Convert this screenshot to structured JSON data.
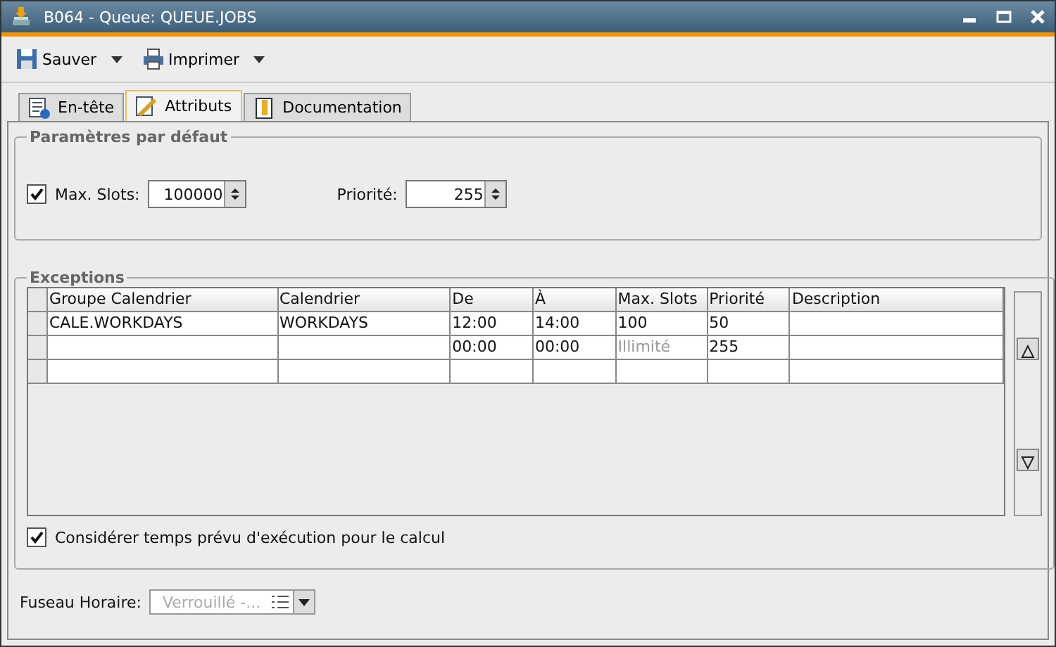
{
  "window": {
    "title": "B064 - Queue: QUEUE.JOBS"
  },
  "toolbar": [
    {
      "label": "Sauver",
      "kind": "save"
    },
    {
      "label": "Imprimer",
      "kind": "print"
    }
  ],
  "tabs": [
    {
      "label": "En-tête",
      "selected": false,
      "kind": "info"
    },
    {
      "label": "Attributs",
      "selected": true,
      "kind": "edit"
    },
    {
      "label": "Documentation",
      "selected": false,
      "kind": "book"
    }
  ],
  "defaults": {
    "title": "Paramètres par défaut",
    "max_slots": {
      "label": "Max. Slots:",
      "checked": true,
      "value": "100000"
    },
    "priority": {
      "label": "Priorité:",
      "value": "255"
    }
  },
  "exceptions": {
    "title": "Exceptions",
    "columns": [
      "Groupe Calendrier",
      "Calendrier",
      "De",
      "À",
      "Max. Slots",
      "Priorité",
      "Description"
    ],
    "rows": [
      {
        "groupe_calendrier": "CALE.WORKDAYS",
        "calendrier": "WORKDAYS",
        "de": "12:00",
        "a": "14:00",
        "max_slots": "100",
        "max_slots_unlimited": false,
        "priorite": "50"
      },
      {
        "de": "00:00",
        "a": "00:00",
        "max_slots": "Illimité",
        "max_slots_unlimited": true,
        "priorite": "255"
      },
      {}
    ],
    "consider": {
      "label": "Considérer temps prévu d'exécution pour le calcul",
      "checked": true
    }
  },
  "timezone": {
    "label": "Fuseau Horaire:",
    "value": "Verrouillé -...",
    "disabled": true
  }
}
